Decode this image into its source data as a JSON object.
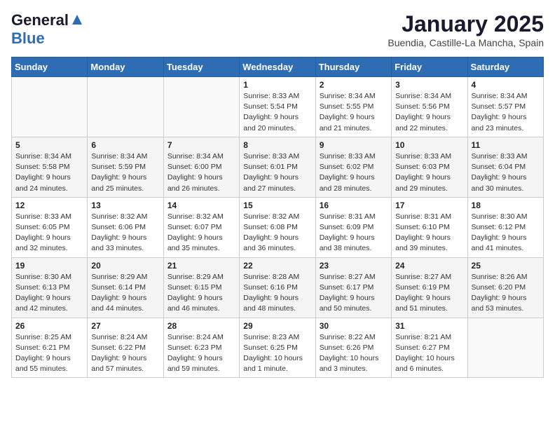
{
  "header": {
    "logo_line1": "General",
    "logo_line2": "Blue",
    "title": "January 2025",
    "subtitle": "Buendia, Castille-La Mancha, Spain"
  },
  "weekdays": [
    "Sunday",
    "Monday",
    "Tuesday",
    "Wednesday",
    "Thursday",
    "Friday",
    "Saturday"
  ],
  "weeks": [
    [
      {
        "day": "",
        "info": ""
      },
      {
        "day": "",
        "info": ""
      },
      {
        "day": "",
        "info": ""
      },
      {
        "day": "1",
        "info": "Sunrise: 8:33 AM\nSunset: 5:54 PM\nDaylight: 9 hours\nand 20 minutes."
      },
      {
        "day": "2",
        "info": "Sunrise: 8:34 AM\nSunset: 5:55 PM\nDaylight: 9 hours\nand 21 minutes."
      },
      {
        "day": "3",
        "info": "Sunrise: 8:34 AM\nSunset: 5:56 PM\nDaylight: 9 hours\nand 22 minutes."
      },
      {
        "day": "4",
        "info": "Sunrise: 8:34 AM\nSunset: 5:57 PM\nDaylight: 9 hours\nand 23 minutes."
      }
    ],
    [
      {
        "day": "5",
        "info": "Sunrise: 8:34 AM\nSunset: 5:58 PM\nDaylight: 9 hours\nand 24 minutes."
      },
      {
        "day": "6",
        "info": "Sunrise: 8:34 AM\nSunset: 5:59 PM\nDaylight: 9 hours\nand 25 minutes."
      },
      {
        "day": "7",
        "info": "Sunrise: 8:34 AM\nSunset: 6:00 PM\nDaylight: 9 hours\nand 26 minutes."
      },
      {
        "day": "8",
        "info": "Sunrise: 8:33 AM\nSunset: 6:01 PM\nDaylight: 9 hours\nand 27 minutes."
      },
      {
        "day": "9",
        "info": "Sunrise: 8:33 AM\nSunset: 6:02 PM\nDaylight: 9 hours\nand 28 minutes."
      },
      {
        "day": "10",
        "info": "Sunrise: 8:33 AM\nSunset: 6:03 PM\nDaylight: 9 hours\nand 29 minutes."
      },
      {
        "day": "11",
        "info": "Sunrise: 8:33 AM\nSunset: 6:04 PM\nDaylight: 9 hours\nand 30 minutes."
      }
    ],
    [
      {
        "day": "12",
        "info": "Sunrise: 8:33 AM\nSunset: 6:05 PM\nDaylight: 9 hours\nand 32 minutes."
      },
      {
        "day": "13",
        "info": "Sunrise: 8:32 AM\nSunset: 6:06 PM\nDaylight: 9 hours\nand 33 minutes."
      },
      {
        "day": "14",
        "info": "Sunrise: 8:32 AM\nSunset: 6:07 PM\nDaylight: 9 hours\nand 35 minutes."
      },
      {
        "day": "15",
        "info": "Sunrise: 8:32 AM\nSunset: 6:08 PM\nDaylight: 9 hours\nand 36 minutes."
      },
      {
        "day": "16",
        "info": "Sunrise: 8:31 AM\nSunset: 6:09 PM\nDaylight: 9 hours\nand 38 minutes."
      },
      {
        "day": "17",
        "info": "Sunrise: 8:31 AM\nSunset: 6:10 PM\nDaylight: 9 hours\nand 39 minutes."
      },
      {
        "day": "18",
        "info": "Sunrise: 8:30 AM\nSunset: 6:12 PM\nDaylight: 9 hours\nand 41 minutes."
      }
    ],
    [
      {
        "day": "19",
        "info": "Sunrise: 8:30 AM\nSunset: 6:13 PM\nDaylight: 9 hours\nand 42 minutes."
      },
      {
        "day": "20",
        "info": "Sunrise: 8:29 AM\nSunset: 6:14 PM\nDaylight: 9 hours\nand 44 minutes."
      },
      {
        "day": "21",
        "info": "Sunrise: 8:29 AM\nSunset: 6:15 PM\nDaylight: 9 hours\nand 46 minutes."
      },
      {
        "day": "22",
        "info": "Sunrise: 8:28 AM\nSunset: 6:16 PM\nDaylight: 9 hours\nand 48 minutes."
      },
      {
        "day": "23",
        "info": "Sunrise: 8:27 AM\nSunset: 6:17 PM\nDaylight: 9 hours\nand 50 minutes."
      },
      {
        "day": "24",
        "info": "Sunrise: 8:27 AM\nSunset: 6:19 PM\nDaylight: 9 hours\nand 51 minutes."
      },
      {
        "day": "25",
        "info": "Sunrise: 8:26 AM\nSunset: 6:20 PM\nDaylight: 9 hours\nand 53 minutes."
      }
    ],
    [
      {
        "day": "26",
        "info": "Sunrise: 8:25 AM\nSunset: 6:21 PM\nDaylight: 9 hours\nand 55 minutes."
      },
      {
        "day": "27",
        "info": "Sunrise: 8:24 AM\nSunset: 6:22 PM\nDaylight: 9 hours\nand 57 minutes."
      },
      {
        "day": "28",
        "info": "Sunrise: 8:24 AM\nSunset: 6:23 PM\nDaylight: 9 hours\nand 59 minutes."
      },
      {
        "day": "29",
        "info": "Sunrise: 8:23 AM\nSunset: 6:25 PM\nDaylight: 10 hours\nand 1 minute."
      },
      {
        "day": "30",
        "info": "Sunrise: 8:22 AM\nSunset: 6:26 PM\nDaylight: 10 hours\nand 3 minutes."
      },
      {
        "day": "31",
        "info": "Sunrise: 8:21 AM\nSunset: 6:27 PM\nDaylight: 10 hours\nand 6 minutes."
      },
      {
        "day": "",
        "info": ""
      }
    ]
  ]
}
